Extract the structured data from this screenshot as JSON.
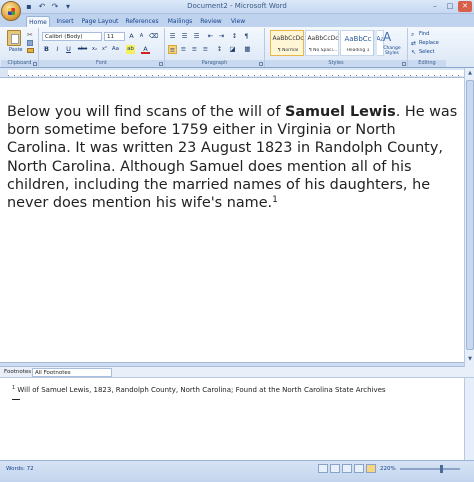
{
  "window": {
    "title": "Document2 - Microsoft Word",
    "minimize": "–",
    "maximize": "□",
    "close": "✕"
  },
  "quick_access": {
    "save_icon": "save-icon",
    "undo_icon": "undo-icon",
    "redo_icon": "redo-icon"
  },
  "tabs": [
    "Home",
    "Insert",
    "Page Layout",
    "References",
    "Mailings",
    "Review",
    "View"
  ],
  "ribbon": {
    "clipboard": {
      "paste_label": "Paste",
      "group_label": "Clipboard"
    },
    "font": {
      "font_name": "Calibri (Body)",
      "font_size": "11",
      "group_label": "Font",
      "bold": "B",
      "italic": "I",
      "underline": "U",
      "strike": "abe",
      "subscript": "x₂",
      "superscript": "x²",
      "case": "Aa",
      "highlight": "ab",
      "color": "A"
    },
    "paragraph": {
      "group_label": "Paragraph"
    },
    "styles": {
      "group_label": "Styles",
      "items": [
        {
          "preview": "AaBbCcDc",
          "name": "¶ Normal"
        },
        {
          "preview": "AaBbCcDc",
          "name": "¶ No Spaci..."
        },
        {
          "preview": "AaBbCc",
          "name": "Heading 1"
        },
        {
          "preview": "AaBbC",
          "name": ""
        }
      ],
      "change_styles": "Change Styles"
    },
    "editing": {
      "group_label": "Editing",
      "find": "Find",
      "replace": "Replace",
      "select": "Select"
    }
  },
  "document": {
    "text_before": "Below you will find scans of the will of ",
    "bold_name": "Samuel Lewis",
    "text_after": ". He was born sometime before 1759 either in Virginia or North Carolina. It was written 23 August 1823 in Randolph County, North Carolina. Although Samuel does mention all of his children, including the married names of his daughters, he never does mention his wife's name.",
    "footnote_ref": "1"
  },
  "footnotes_pane": {
    "label": "Footnotes",
    "selector_value": "All Footnotes",
    "footnote_number": "1",
    "footnote_text": " Will of Samuel Lewis, 1823, Randolph County, North Carolina; Found at the North Carolina State Archives"
  },
  "status_bar": {
    "words": "Words: 72",
    "zoom": "220%"
  }
}
